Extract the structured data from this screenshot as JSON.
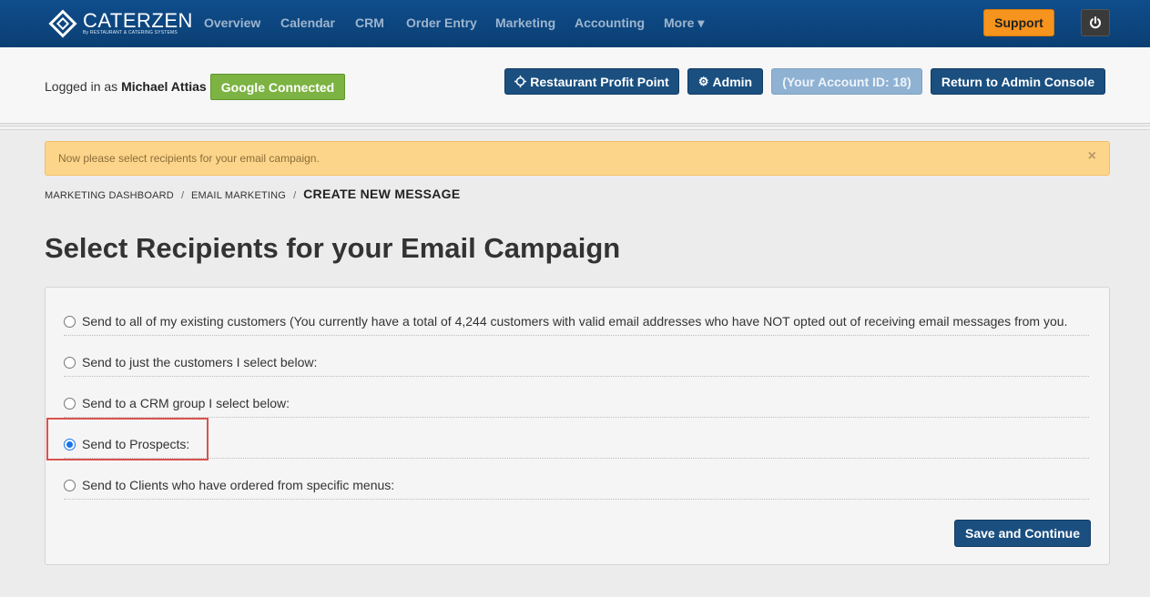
{
  "brand": {
    "name": "CATERZEN",
    "tagline": "By RESTAURANT & CATERING SYSTEMS"
  },
  "nav": {
    "items": [
      "Overview",
      "Calendar",
      "CRM",
      "Order Entry",
      "Marketing",
      "Accounting",
      "More"
    ],
    "more_caret": "▾",
    "support_label": "Support",
    "power_icon": "power-icon"
  },
  "header": {
    "logged_prefix": "Logged in as",
    "user_name": "Michael Attias",
    "google_label": "Google Connected",
    "profit_point_label": "Restaurant Profit Point",
    "admin_label": "Admin",
    "account_id_label": "(Your Account ID: 18)",
    "return_label": "Return to Admin Console"
  },
  "alert": {
    "text": "Now please select recipients for your email campaign.",
    "close": "×"
  },
  "breadcrumb": {
    "items": [
      "MARKETING DASHBOARD",
      "EMAIL MARKETING"
    ],
    "separator": "/",
    "current": "CREATE NEW MESSAGE"
  },
  "page": {
    "title": "Select Recipients for your Email Campaign"
  },
  "recipients": {
    "options": [
      {
        "label": "Send to all of my existing customers (You currently have a total of 4,244 customers with valid email addresses who have NOT opted out of receiving email messages from you.",
        "checked": false
      },
      {
        "label": "Send to just the customers I select below:",
        "checked": false
      },
      {
        "label": "Send to a CRM group I select below:",
        "checked": false
      },
      {
        "label": "Send to Prospects:",
        "checked": true
      },
      {
        "label": "Send to Clients who have ordered from specific menus:",
        "checked": false
      }
    ],
    "save_label": "Save and Continue"
  },
  "colors": {
    "navbar": "#0f4d8c",
    "support": "#f7941d",
    "google": "#7cb342",
    "primary_button": "#1a4f80",
    "alert_bg": "#fdd58a",
    "highlight_box": "#d9534f"
  }
}
